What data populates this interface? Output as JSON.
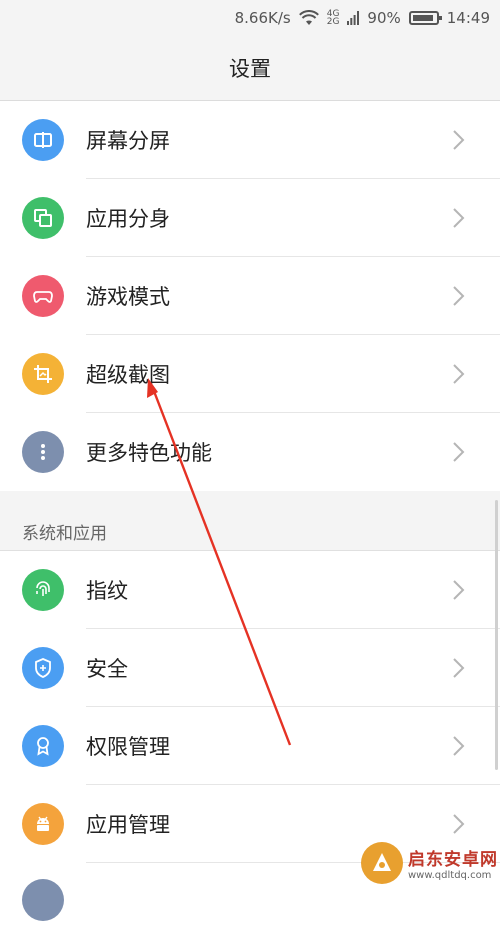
{
  "status_bar": {
    "speed": "8.66K/s",
    "net_top": "4G",
    "net_bottom": "2G",
    "battery_pct": "90%",
    "battery_level": 0.9,
    "time": "14:49"
  },
  "header": {
    "title": "设置"
  },
  "features": [
    {
      "label": "屏幕分屏",
      "icon": "split-screen-icon",
      "color": "#4b9ef2"
    },
    {
      "label": "应用分身",
      "icon": "app-clone-icon",
      "color": "#3fbf6a"
    },
    {
      "label": "游戏模式",
      "icon": "gamepad-icon",
      "color": "#ef5a6e"
    },
    {
      "label": "超级截图",
      "icon": "screenshot-crop-icon",
      "color": "#f4b236"
    },
    {
      "label": "更多特色功能",
      "icon": "more-dots-icon",
      "color": "#7d8fae"
    }
  ],
  "system_section": {
    "title": "系统和应用",
    "items": [
      {
        "label": "指纹",
        "icon": "fingerprint-icon",
        "color": "#3fbf6a"
      },
      {
        "label": "安全",
        "icon": "shield-icon",
        "color": "#4b9ef2"
      },
      {
        "label": "权限管理",
        "icon": "badge-icon",
        "color": "#4b9ef2"
      },
      {
        "label": "应用管理",
        "icon": "android-icon",
        "color": "#f4a33c"
      }
    ]
  },
  "watermark": {
    "title": "启东安卓网",
    "url": "www.qdltdq.com"
  }
}
